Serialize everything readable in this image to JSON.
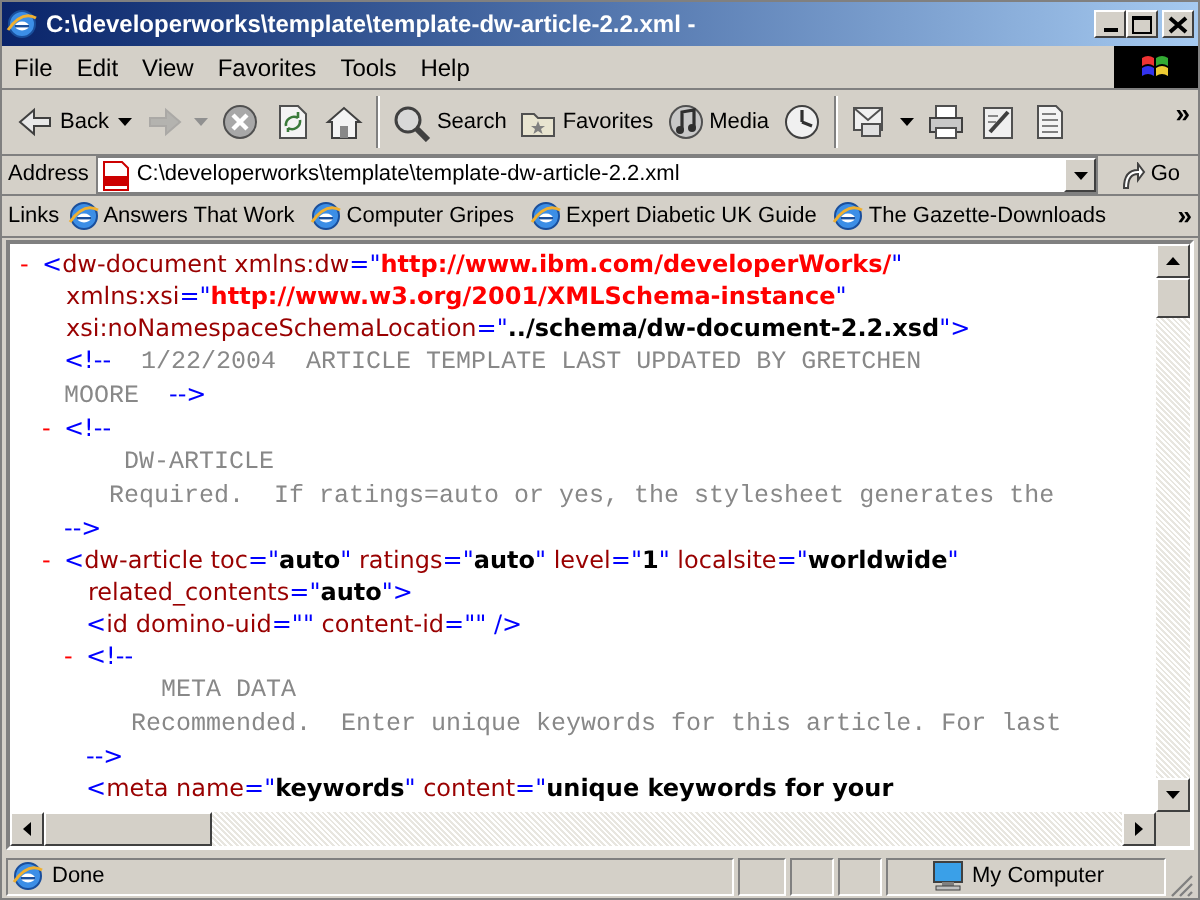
{
  "window": {
    "title": "C:\\developerworks\\template\\template-dw-article-2.2.xml -"
  },
  "menu": [
    "File",
    "Edit",
    "View",
    "Favorites",
    "Tools",
    "Help"
  ],
  "toolbar": [
    [
      {
        "label": "Back",
        "dropdown": true,
        "disabled": false
      },
      {
        "dropdown": true,
        "disabled": true
      },
      {
        "dropdown": false,
        "disabled": false
      },
      {
        "dropdown": false,
        "disabled": false
      },
      {
        "dropdown": false,
        "disabled": false
      }
    ],
    [
      {
        "label": "Search",
        "dropdown": false,
        "disabled": false
      },
      {
        "label": "Favorites",
        "dropdown": false,
        "disabled": false
      },
      {
        "label": "Media",
        "dropdown": false,
        "disabled": false
      },
      {
        "dropdown": false,
        "disabled": false
      }
    ],
    [
      {
        "dropdown": true,
        "disabled": false
      },
      {
        "dropdown": false,
        "disabled": false
      },
      {
        "dropdown": false,
        "disabled": false
      },
      {
        "dropdown": false,
        "disabled": false
      }
    ]
  ],
  "toolbar_more": "»",
  "address": {
    "label": "Address",
    "value": "C:\\developerworks\\template\\template-dw-article-2.2.xml",
    "go": "Go"
  },
  "links": {
    "label": "Links",
    "items": [
      "Answers That Work",
      "Computer Gripes",
      "Expert Diabetic UK Guide",
      "The Gazette-Downloads"
    ],
    "more": "»"
  },
  "document": [
    {
      "kind": "element",
      "toggle": "-",
      "lines": [
        [
          {
            "kind": "mark",
            "text": "<"
          },
          {
            "kind": "name",
            "text": "dw-document xmlns:dw"
          },
          {
            "kind": "mark",
            "text": "=\""
          },
          {
            "kind": "ns",
            "text": "http://www.ibm.com/developerWorks/"
          },
          {
            "kind": "mark",
            "text": "\""
          }
        ],
        [
          {
            "kind": "name",
            "text": "xmlns:xsi"
          },
          {
            "kind": "mark",
            "text": "=\""
          },
          {
            "kind": "ns",
            "text": "http://www.w3.org/2001/XMLSchema-instance"
          },
          {
            "kind": "mark",
            "text": "\""
          }
        ],
        [
          {
            "kind": "name",
            "text": "xsi:noNamespaceSchemaLocation"
          },
          {
            "kind": "mark",
            "text": "=\""
          },
          {
            "kind": "value",
            "text": "../schema/dw-document-2.2.xsd"
          },
          {
            "kind": "mark",
            "text": "\">"
          }
        ]
      ],
      "children": [
        {
          "kind": "comment",
          "lines": [
            [
              {
                "kind": "mark",
                "text": "<!--"
              },
              {
                "kind": "comment",
                "text": "  1/22/2004  ARTICLE TEMPLATE LAST UPDATED BY GRETCHEN"
              }
            ],
            [
              {
                "kind": "comment",
                "text": "MOORE  "
              },
              {
                "kind": "mark",
                "text": "-->"
              }
            ]
          ]
        },
        {
          "kind": "comment",
          "toggle": "-",
          "lines": [
            [
              {
                "kind": "mark",
                "text": "<!--"
              }
            ],
            [
              {
                "kind": "comment",
                "text": "    DW-ARTICLE"
              }
            ],
            [
              {
                "kind": "comment",
                "text": "   Required.  If ratings=auto or yes, the stylesheet generates the"
              }
            ],
            [
              {
                "kind": "mark",
                "text": "-->"
              }
            ]
          ]
        },
        {
          "kind": "element",
          "toggle": "-",
          "lines": [
            [
              {
                "kind": "mark",
                "text": "<"
              },
              {
                "kind": "name",
                "text": "dw-article toc"
              },
              {
                "kind": "mark",
                "text": "=\""
              },
              {
                "kind": "value",
                "text": "auto"
              },
              {
                "kind": "mark",
                "text": "\" "
              },
              {
                "kind": "name",
                "text": "ratings"
              },
              {
                "kind": "mark",
                "text": "=\""
              },
              {
                "kind": "value",
                "text": "auto"
              },
              {
                "kind": "mark",
                "text": "\" "
              },
              {
                "kind": "name",
                "text": "level"
              },
              {
                "kind": "mark",
                "text": "=\""
              },
              {
                "kind": "value",
                "text": "1"
              },
              {
                "kind": "mark",
                "text": "\" "
              },
              {
                "kind": "name",
                "text": "localsite"
              },
              {
                "kind": "mark",
                "text": "=\""
              },
              {
                "kind": "value",
                "text": "worldwide"
              },
              {
                "kind": "mark",
                "text": "\""
              }
            ],
            [
              {
                "kind": "name",
                "text": "related_contents"
              },
              {
                "kind": "mark",
                "text": "=\""
              },
              {
                "kind": "value",
                "text": "auto"
              },
              {
                "kind": "mark",
                "text": "\">"
              }
            ]
          ],
          "children": [
            {
              "kind": "element",
              "lines": [
                [
                  {
                    "kind": "mark",
                    "text": "<"
                  },
                  {
                    "kind": "name",
                    "text": "id domino-uid"
                  },
                  {
                    "kind": "mark",
                    "text": "=\"\" "
                  },
                  {
                    "kind": "name",
                    "text": "content-id"
                  },
                  {
                    "kind": "mark",
                    "text": "=\"\" />"
                  }
                ]
              ]
            },
            {
              "kind": "comment",
              "toggle": "-",
              "lines": [
                [
                  {
                    "kind": "mark",
                    "text": "<!--"
                  }
                ],
                [
                  {
                    "kind": "comment",
                    "text": "     META DATA"
                  }
                ],
                [
                  {
                    "kind": "comment",
                    "text": "   Recommended.  Enter unique keywords for this article. For last"
                  }
                ],
                [
                  {
                    "kind": "mark",
                    "text": "-->"
                  }
                ]
              ]
            },
            {
              "kind": "element",
              "lines": [
                [
                  {
                    "kind": "mark",
                    "text": "<"
                  },
                  {
                    "kind": "name",
                    "text": "meta name"
                  },
                  {
                    "kind": "mark",
                    "text": "=\""
                  },
                  {
                    "kind": "value",
                    "text": "keywords"
                  },
                  {
                    "kind": "mark",
                    "text": "\" "
                  },
                  {
                    "kind": "name",
                    "text": "content"
                  },
                  {
                    "kind": "mark",
                    "text": "=\""
                  },
                  {
                    "kind": "value",
                    "text": "unique keywords for your"
                  }
                ]
              ]
            }
          ]
        }
      ]
    }
  ],
  "status_bar": {
    "text": "Done",
    "zone": "My Computer"
  }
}
